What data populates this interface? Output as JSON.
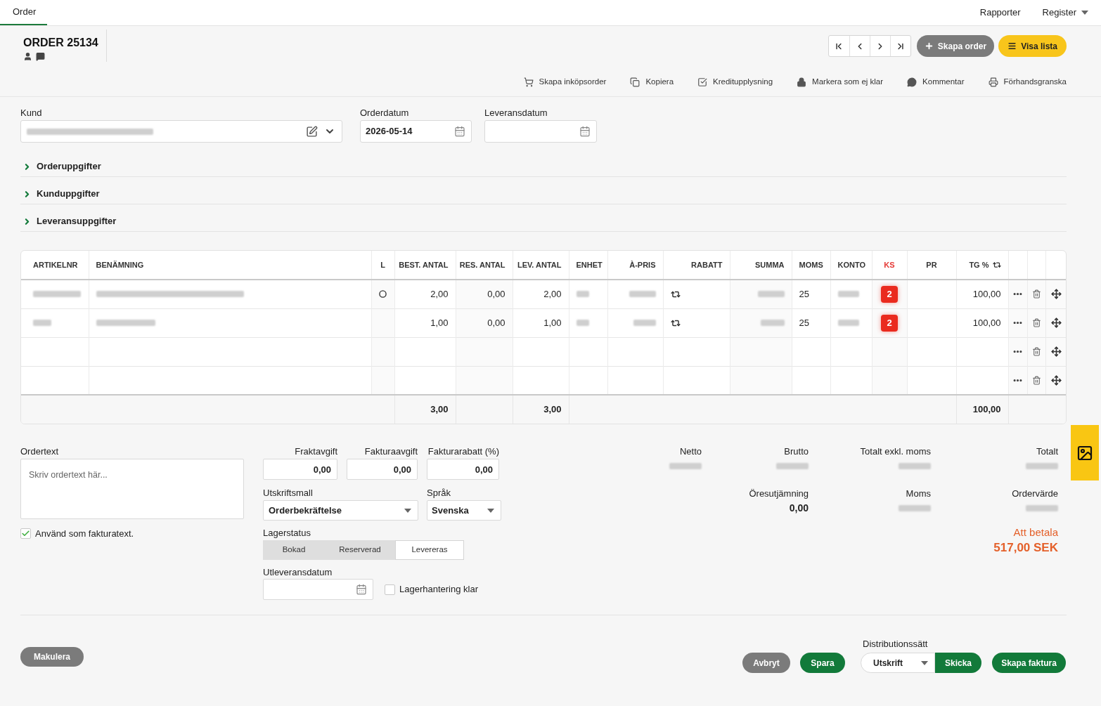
{
  "top_nav": {
    "tabs": [
      {
        "label": "Order",
        "selected": true
      }
    ],
    "menu": [
      {
        "label": "Rapporter",
        "kind": "link"
      },
      {
        "label": "Register",
        "kind": "dropdown"
      }
    ]
  },
  "header": {
    "title": "ORDER 25134",
    "buttons": [
      {
        "label": "Skapa order",
        "kind": "secondary"
      },
      {
        "label": "Visa lista",
        "kind": "primary"
      }
    ]
  },
  "toolbar": [
    {
      "label": "Skapa inköpsorder"
    },
    {
      "label": "Kopiera"
    },
    {
      "label": "Kreditupplysning"
    },
    {
      "label": "Markera som ej klar"
    },
    {
      "label": "Kommentar"
    },
    {
      "label": "Förhandsgranska"
    }
  ],
  "order_fields": {
    "kund": {
      "label": "Kund",
      "value": {
        "kind": "blurred"
      }
    },
    "orderdatum": {
      "label": "Orderdatum",
      "value": "2026-05-14"
    },
    "leveransdatum": {
      "label": "Leveransdatum"
    }
  },
  "sections": [
    {
      "title": "Orderuppgifter",
      "expanded": false
    },
    {
      "title": "Kunduppgifter",
      "expanded": false
    },
    {
      "title": "Leveransuppgifter",
      "expanded": false
    }
  ],
  "table": {
    "columns": [
      {
        "label": "ARTIKELNR"
      },
      {
        "label": "BENÄMNING"
      },
      {
        "label": "L"
      },
      {
        "label": "BEST. ANTAL"
      },
      {
        "label": "RES. ANTAL"
      },
      {
        "label": "LEV. ANTAL"
      },
      {
        "label": "ENHET"
      },
      {
        "label": "À-PRIS"
      },
      {
        "label": "RABATT"
      },
      {
        "label": "SUMMA"
      },
      {
        "label": "MOMS"
      },
      {
        "label": "KONTO"
      },
      {
        "label": "KS",
        "color": "#e53935"
      },
      {
        "label": "PR"
      },
      {
        "label": "TG %"
      }
    ],
    "rows": [
      {
        "kind": "item",
        "cells": [
          {
            "kind": "blurred"
          },
          {
            "kind": "blurred"
          },
          {
            "kind": "status"
          },
          {
            "kind": "text",
            "text": "2,00"
          },
          {
            "kind": "text",
            "text": "0,00"
          },
          {
            "kind": "text",
            "text": "2,00"
          },
          {
            "kind": "blurred"
          },
          {
            "kind": "blurred"
          },
          {
            "kind": "toggle"
          },
          {
            "kind": "blurred"
          },
          {
            "kind": "text",
            "text": "25"
          },
          {
            "kind": "blurred"
          },
          {
            "kind": "badge",
            "text": "2"
          },
          {
            "kind": "empty"
          },
          {
            "kind": "text",
            "text": "100,00"
          }
        ]
      },
      {
        "kind": "item",
        "cells": [
          {
            "kind": "blurred"
          },
          {
            "kind": "blurred"
          },
          {
            "kind": "empty"
          },
          {
            "kind": "text",
            "text": "1,00"
          },
          {
            "kind": "text",
            "text": "0,00"
          },
          {
            "kind": "text",
            "text": "1,00"
          },
          {
            "kind": "blurred"
          },
          {
            "kind": "blurred"
          },
          {
            "kind": "toggle"
          },
          {
            "kind": "blurred"
          },
          {
            "kind": "text",
            "text": "25"
          },
          {
            "kind": "blurred"
          },
          {
            "kind": "badge",
            "text": "2"
          },
          {
            "kind": "empty"
          },
          {
            "kind": "text",
            "text": "100,00"
          }
        ]
      },
      {
        "kind": "blank"
      },
      {
        "kind": "blank"
      }
    ],
    "footer": {
      "best_antal": "3,00",
      "lev_antal": "3,00",
      "tg_procent": "100,00"
    }
  },
  "order_text": {
    "label": "Ordertext",
    "placeholder": "Skriv ordertext här...",
    "use_as_invoice_text": {
      "label": "Använd som fakturatext.",
      "checked": true
    }
  },
  "fees": [
    {
      "label": "Fraktavgift",
      "value": "0,00"
    },
    {
      "label": "Fakturaavgift",
      "value": "0,00"
    },
    {
      "label": "Fakturarabatt (%)",
      "value": "0,00"
    }
  ],
  "print_template": {
    "label": "Utskriftsmall",
    "value": "Orderbekräftelse"
  },
  "language": {
    "label": "Språk",
    "value": "Svenska"
  },
  "stock_status": {
    "label": "Lagerstatus",
    "options": [
      {
        "label": "Bokad",
        "selected": false
      },
      {
        "label": "Reserverad",
        "selected": false
      },
      {
        "label": "Levereras",
        "selected": true
      }
    ]
  },
  "delivery_out": {
    "label": "Utleveransdatum",
    "stock_handling_done": {
      "label": "Lagerhantering klar",
      "checked": false
    }
  },
  "totals": [
    {
      "label": "Netto",
      "value": {
        "kind": "blurred"
      }
    },
    {
      "label": "Brutto",
      "value": {
        "kind": "blurred"
      }
    },
    {
      "label": "Totalt exkl. moms",
      "value": {
        "kind": "blurred"
      }
    },
    {
      "label": "Totalt",
      "value": {
        "kind": "blurred"
      }
    },
    {
      "label": "Öresutjämning",
      "value": {
        "kind": "text",
        "text": "0,00"
      }
    },
    {
      "label": "Moms",
      "value": {
        "kind": "blurred"
      }
    },
    {
      "label": "Ordervärde",
      "value": {
        "kind": "blurred"
      }
    }
  ],
  "amount_due": {
    "label": "Att betala",
    "value": "517,00 SEK"
  },
  "footer": {
    "void_button": "Makulera",
    "buttons": [
      {
        "label": "Avbryt",
        "kind": "secondary"
      },
      {
        "label": "Spara",
        "kind": "primary"
      }
    ],
    "distribution": {
      "label": "Distributionssätt",
      "value": "Utskrift",
      "send_button": "Skicka"
    },
    "create_invoice": "Skapa faktura"
  }
}
